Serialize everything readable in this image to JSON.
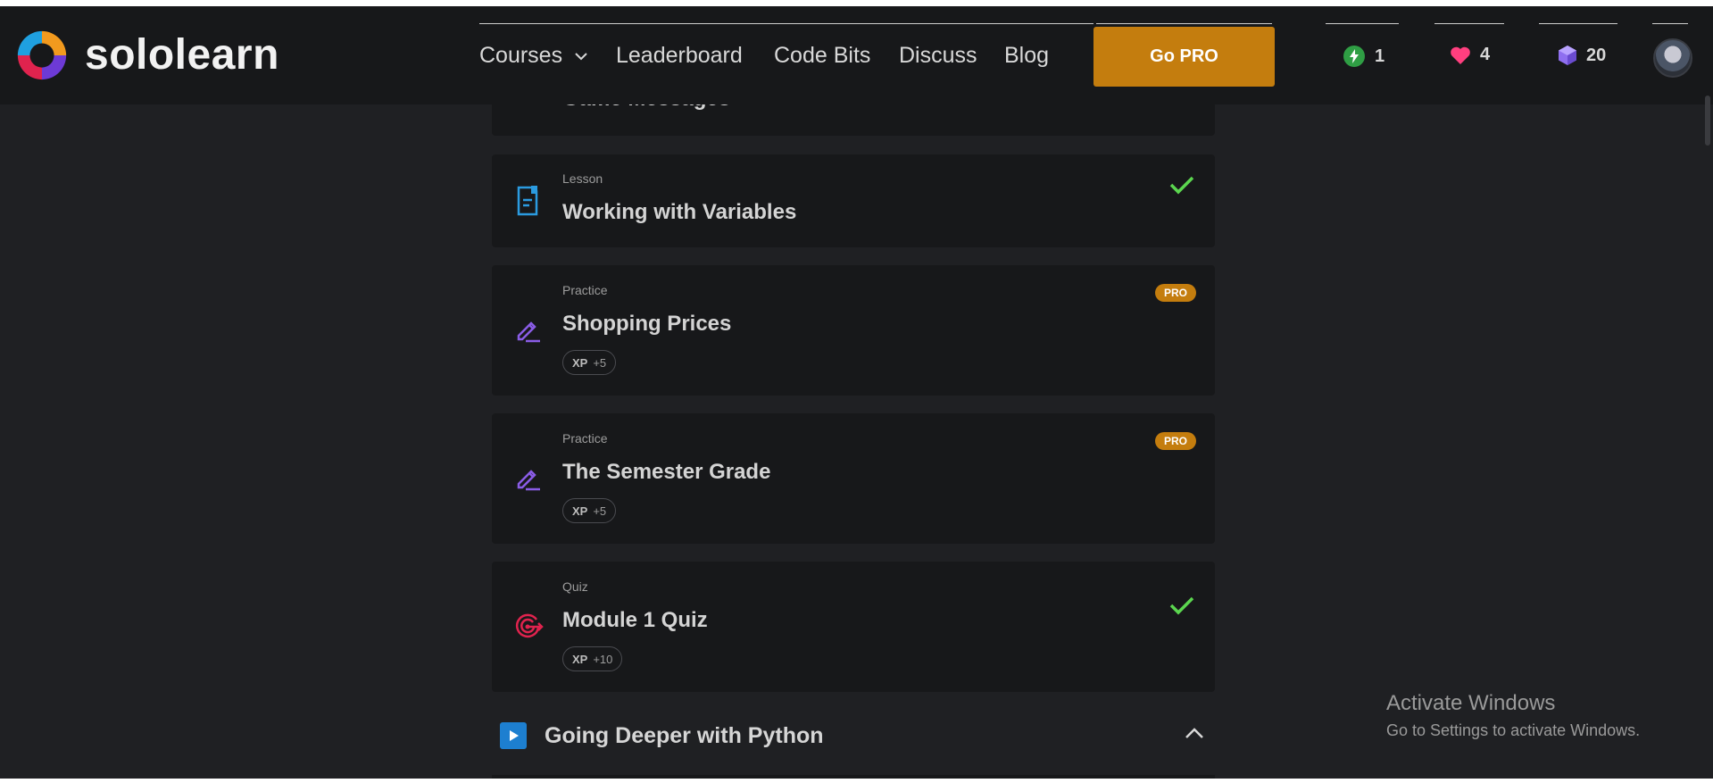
{
  "brand": {
    "name": "sololearn"
  },
  "nav": {
    "courses": "Courses",
    "leaderboard": "Leaderboard",
    "code_bits": "Code Bits",
    "discuss": "Discuss",
    "blog": "Blog",
    "go_pro": "Go PRO"
  },
  "stats": {
    "streak": "1",
    "hearts": "4",
    "gems": "20"
  },
  "partial_card": {
    "title": "Game Messages"
  },
  "lessons": [
    {
      "type": "Lesson",
      "title": "Working with Variables",
      "completed": true,
      "icon": "document-icon"
    },
    {
      "type": "Practice",
      "title": "Shopping Prices",
      "pro": "PRO",
      "xp_label": "XP",
      "xp_value": "+5",
      "icon": "pencil-icon"
    },
    {
      "type": "Practice",
      "title": "The Semester Grade",
      "pro": "PRO",
      "xp_label": "XP",
      "xp_value": "+5",
      "icon": "pencil-icon"
    },
    {
      "type": "Quiz",
      "title": "Module 1 Quiz",
      "completed": true,
      "xp_label": "XP",
      "xp_value": "+10",
      "icon": "target-icon"
    }
  ],
  "section": {
    "title": "Going Deeper with Python"
  },
  "watermark": {
    "line1": "Activate Windows",
    "line2": "Go to Settings to activate Windows."
  },
  "colors": {
    "background": "#1f2023",
    "card": "#17181a",
    "pro": "#c47d0e",
    "check": "#5bd64f",
    "lesson_icon": "#2b9be0",
    "practice_icon": "#8a5ce6",
    "quiz_icon": "#e0234e"
  }
}
